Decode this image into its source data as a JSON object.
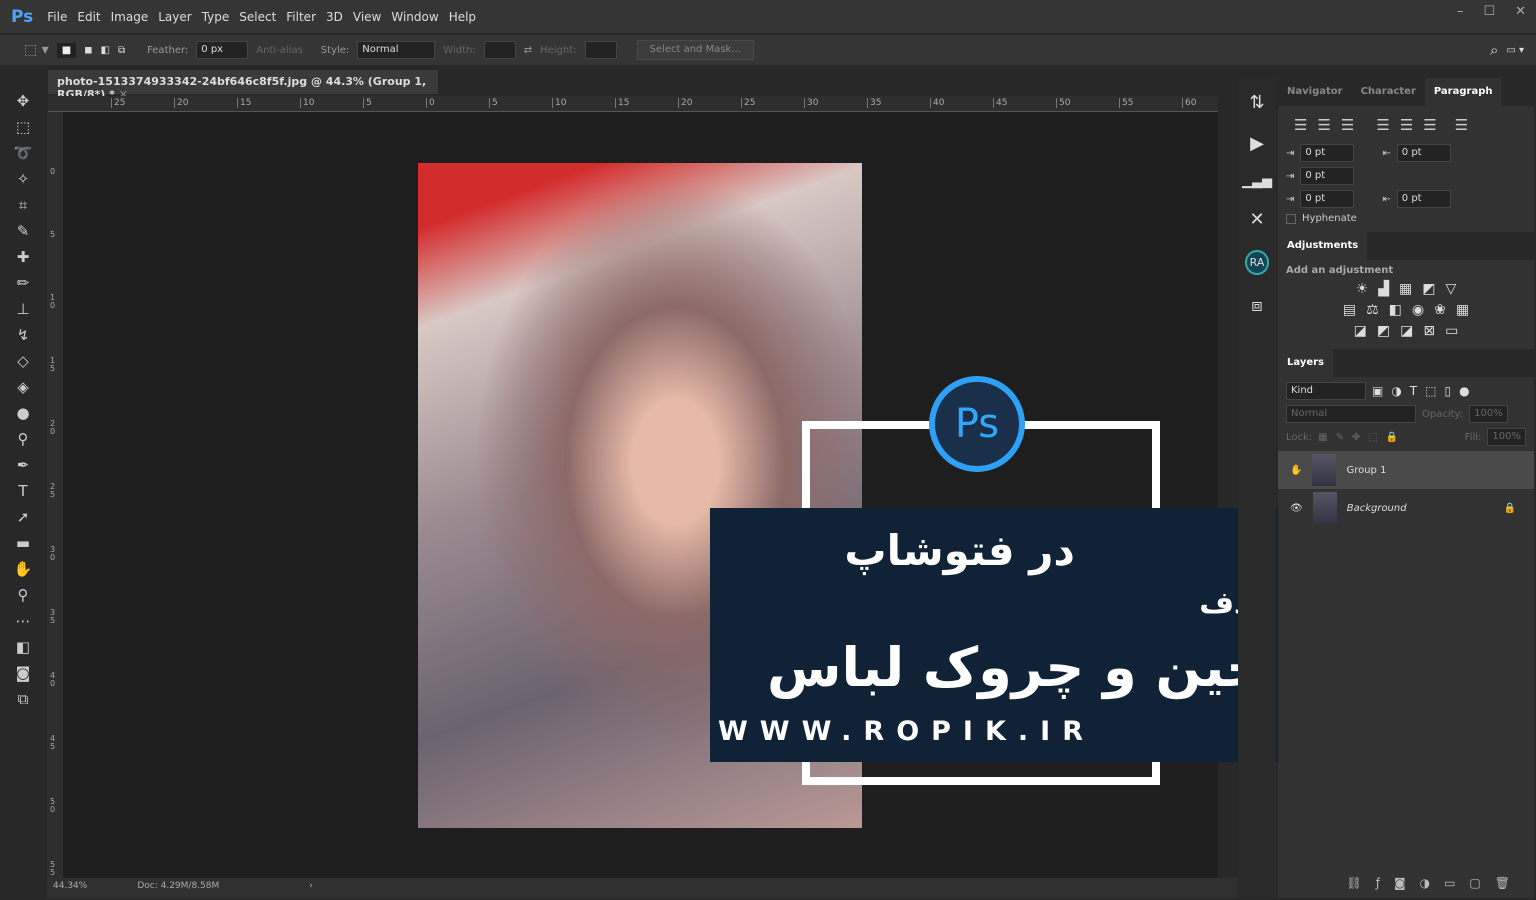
{
  "app": {
    "logo": "Ps",
    "menu": [
      "File",
      "Edit",
      "Image",
      "Layer",
      "Type",
      "Select",
      "Filter",
      "3D",
      "View",
      "Window",
      "Help"
    ]
  },
  "options": {
    "feather_label": "Feather:",
    "feather_value": "0 px",
    "antialias": "Anti-alias",
    "style_label": "Style:",
    "style_value": "Normal",
    "width_label": "Width:",
    "height_label": "Height:",
    "select_mask": "Select and Mask..."
  },
  "document": {
    "tab_title": "photo-1513374933342-24bf646c8f5f.jpg @ 44.3% (Group 1, RGB/8*) *",
    "zoom": "44.34%",
    "doc_size": "Doc: 4.29M/8.58M"
  },
  "rulers": {
    "h": [
      "25",
      "20",
      "15",
      "10",
      "5",
      "0",
      "5",
      "10",
      "15",
      "20",
      "25",
      "30",
      "35",
      "40",
      "45",
      "50",
      "55",
      "60"
    ],
    "v": [
      "0",
      "5",
      "10",
      "15",
      "20",
      "25",
      "30",
      "35",
      "40",
      "45",
      "50",
      "55"
    ]
  },
  "overlay": {
    "ps": "Ps",
    "line1": "در فتوشاپ",
    "line2": "حذف",
    "line3": "چین و چروک لباس",
    "url": "WWW.ROPIK.IR"
  },
  "panels": {
    "tabs": [
      "Navigator",
      "Character",
      "Paragraph"
    ],
    "indent": [
      "0 pt",
      "0 pt",
      "0 pt",
      "0 pt",
      "0 pt"
    ],
    "hyphenate": "Hyphenate",
    "adjustments": "Adjustments",
    "add_adjustment": "Add an adjustment",
    "layers": "Layers",
    "kind": "Kind",
    "blend": "Normal",
    "opacity_label": "Opacity:",
    "opacity": "100%",
    "lock_label": "Lock:",
    "fill_label": "Fill:",
    "fill": "100%",
    "layer_items": [
      "Group 1",
      "Background"
    ]
  },
  "colors": {
    "accent": "#31a8ff",
    "banner": "#0f2236"
  }
}
